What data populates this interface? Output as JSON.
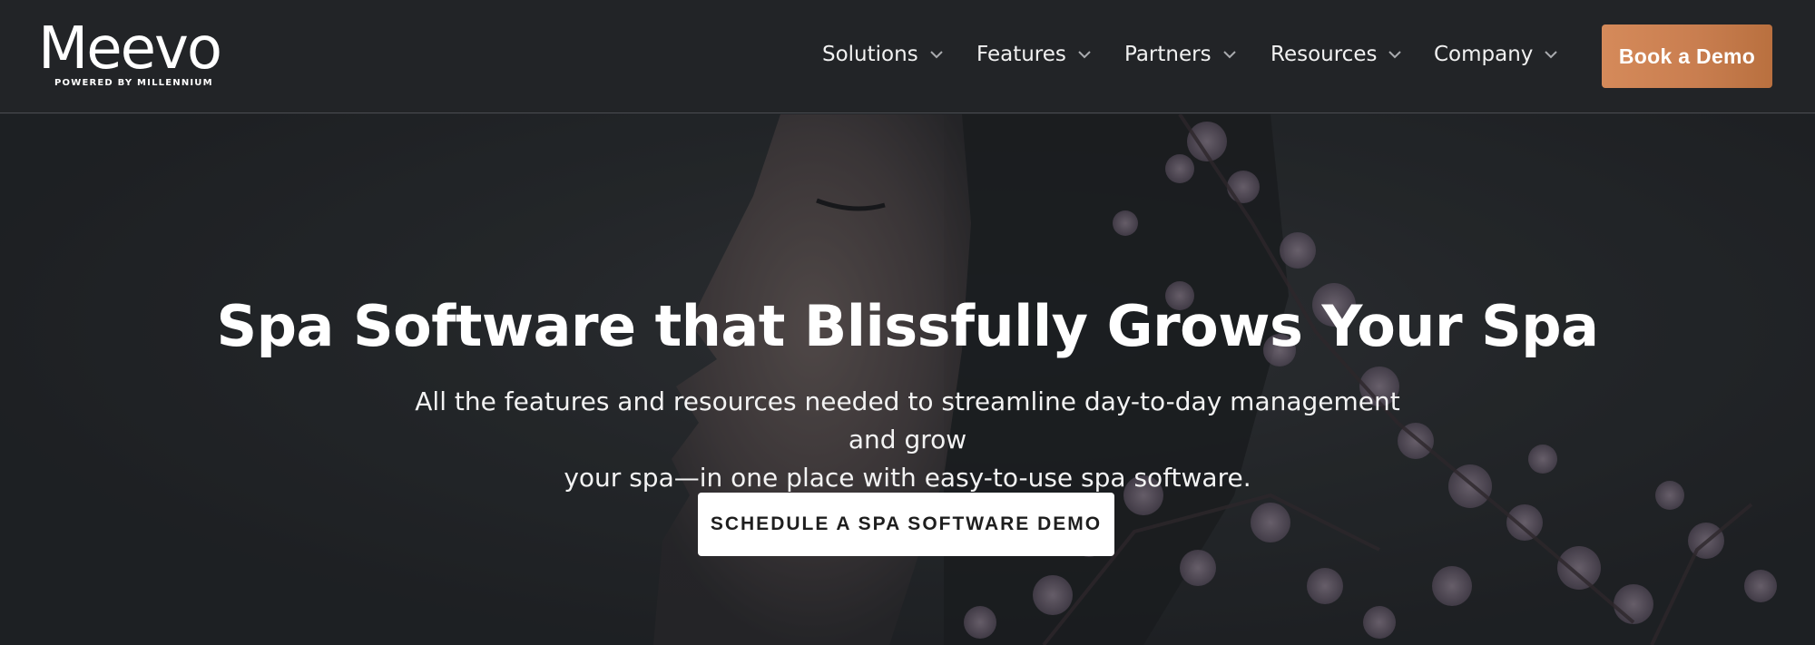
{
  "brand": {
    "logo_text": "Meevo",
    "tagline": "POWERED BY MILLENNIUM"
  },
  "nav": {
    "items": [
      {
        "label": "Solutions"
      },
      {
        "label": "Features"
      },
      {
        "label": "Partners"
      },
      {
        "label": "Resources"
      },
      {
        "label": "Company"
      }
    ],
    "cta_label": "Book a Demo"
  },
  "hero": {
    "title": "Spa Software that Blissfully Grows Your Spa",
    "subtitle_line1": "All the features and resources needed to streamline day-to-day management and grow",
    "subtitle_line2": "your spa—in one place with easy-to-use spa software.",
    "cta_label": "SCHEDULE A SPA SOFTWARE DEMO"
  },
  "colors": {
    "nav_background": "#222427",
    "demo_button": "#c97e50",
    "hero_cta_background": "#ffffff",
    "text_light": "#ffffff"
  },
  "icons": {
    "nav_dropdown": "chevron-down-icon"
  }
}
